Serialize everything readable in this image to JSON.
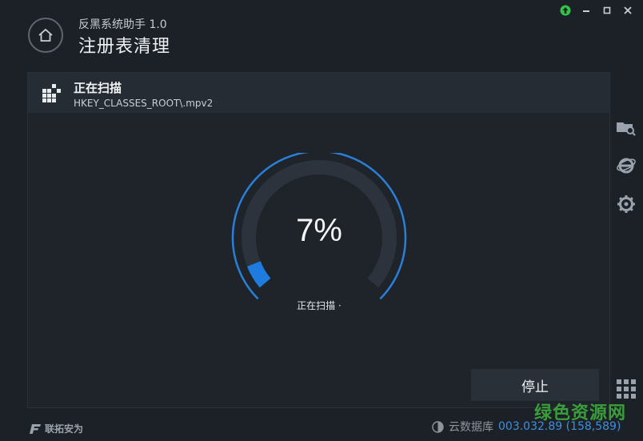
{
  "header": {
    "app_name": "反黑系统助手 1.0",
    "page_title": "注册表清理"
  },
  "scan": {
    "title": "正在扫描",
    "path": "HKEY_CLASSES_ROOT\\.mpv2",
    "percent_label": "7%",
    "progress": 0.07,
    "status": "正在扫描 ·",
    "stop_label": "停止"
  },
  "footer": {
    "brand": "联拓安为",
    "db_label": "云数据库",
    "db_version": "003.032.89 (158,589)"
  },
  "watermark": "绿色资源网",
  "colors": {
    "accent": "#1e7be0",
    "update": "#35c24a",
    "watermark": "#3ba53b"
  }
}
